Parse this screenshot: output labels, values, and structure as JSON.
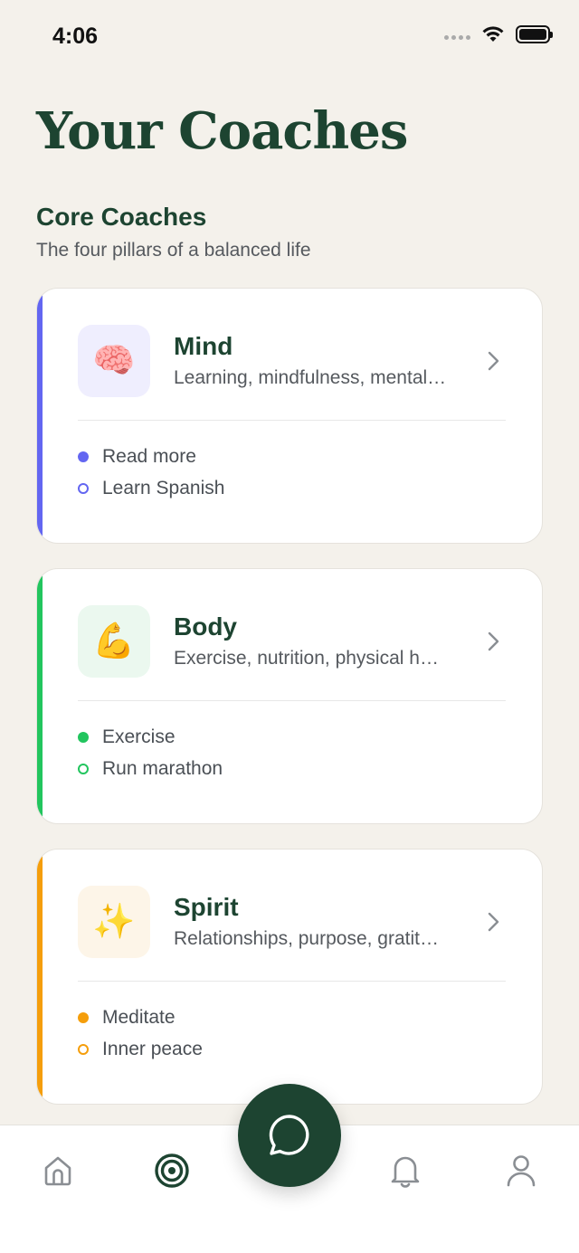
{
  "status_bar": {
    "time": "4:06"
  },
  "header": {
    "title": "Your Coaches"
  },
  "section": {
    "title": "Core Coaches",
    "subtitle": "The four pillars of a balanced life"
  },
  "coaches": [
    {
      "name": "Mind",
      "description": "Learning, mindfulness, mental…",
      "emoji": "🧠",
      "accent_color": "#6366f1",
      "icon_bg": "#efeefe",
      "goals": [
        {
          "label": "Read more",
          "style": "filled"
        },
        {
          "label": "Learn Spanish",
          "style": "hollow"
        }
      ]
    },
    {
      "name": "Body",
      "description": "Exercise, nutrition, physical h…",
      "emoji": "💪",
      "accent_color": "#22c55e",
      "icon_bg": "#ebf8ef",
      "goals": [
        {
          "label": "Exercise",
          "style": "filled"
        },
        {
          "label": "Run marathon",
          "style": "hollow"
        }
      ]
    },
    {
      "name": "Spirit",
      "description": "Relationships, purpose, gratit…",
      "emoji": "✨",
      "accent_color": "#f59e0b",
      "icon_bg": "#fdf5e8",
      "goals": [
        {
          "label": "Meditate",
          "style": "filled"
        },
        {
          "label": "Inner peace",
          "style": "hollow"
        }
      ]
    }
  ],
  "tab_bar": {
    "tabs": [
      {
        "icon": "home-icon",
        "active": false
      },
      {
        "icon": "target-icon",
        "active": true
      },
      {
        "icon": "chat-bubble-icon",
        "active": false
      },
      {
        "icon": "bell-icon",
        "active": false
      },
      {
        "icon": "profile-icon",
        "active": false
      }
    ],
    "active_color": "#1d4431",
    "inactive_color": "#8a8e93"
  }
}
